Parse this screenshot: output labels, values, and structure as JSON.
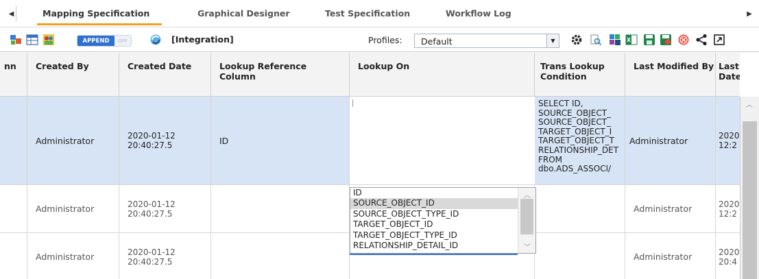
{
  "tabs": [
    {
      "label": "Mapping Specification",
      "active": true
    },
    {
      "label": "Graphical Designer",
      "active": false
    },
    {
      "label": "Test Specification",
      "active": false
    },
    {
      "label": "Workflow Log",
      "active": false
    }
  ],
  "toolbar": {
    "append_on": "APPEND",
    "append_off": "OFF",
    "context_label": "[Integration]",
    "profiles_label": "Profiles:",
    "profile_value": "Default",
    "icons": [
      "model-icon",
      "grid-icon",
      "users-icon",
      "refresh-icon",
      "gear-icon",
      "search-doc-icon",
      "etl-icon",
      "excel-icon",
      "save-icon",
      "save-delete-icon",
      "close-circle-icon",
      "share-icon",
      "expand-icon"
    ]
  },
  "columns": {
    "c0": "nn",
    "c1": "Created By",
    "c2": "Created Date",
    "c3": "Lookup Reference Column",
    "c4": "Lookup On",
    "c5": "Trans Lookup Condition",
    "c6": "Last Modified By",
    "c7": "Last M\nDate T"
  },
  "rows": [
    {
      "created_by": "Administrator",
      "created_date": "2020-01-12\n20:40:27.5",
      "lookup_ref": "ID",
      "lookup_on": "",
      "trans_condition": "SELECT ID,\nSOURCE_OBJECT_\nSOURCE_OBJECT_\nTARGET_OBJECT_I\nTARGET_OBJECT_T\nRELATIONSHIP_DET\nFROM\ndbo.ADS_ASSOCI/",
      "last_modified_by": "Administrator",
      "last_modified_date": "2020\n12:2"
    },
    {
      "created_by": "Administrator",
      "created_date": "2020-01-12\n20:40:27.5",
      "lookup_ref": "",
      "lookup_on": "",
      "trans_condition": "",
      "last_modified_by": "Administrator",
      "last_modified_date": "2020\n12:2"
    },
    {
      "created_by": "Administrator",
      "created_date": "2020-01-12\n20:40:27.5",
      "lookup_ref": "",
      "lookup_on": "",
      "trans_condition": "",
      "last_modified_by": "Administrator",
      "last_modified_date": "2020\n20:4"
    }
  ],
  "dropdown": {
    "options": [
      "ID",
      "SOURCE_OBJECT_ID",
      "SOURCE_OBJECT_TYPE_ID",
      "TARGET_OBJECT_ID",
      "TARGET_OBJECT_TYPE_ID",
      "RELATIONSHIP_DETAIL_ID"
    ],
    "highlighted": "SOURCE_OBJECT_ID"
  },
  "colors": {
    "accent": "#f0a020",
    "selection": "#d6e4f5",
    "append_blue": "#2f6fd0"
  }
}
